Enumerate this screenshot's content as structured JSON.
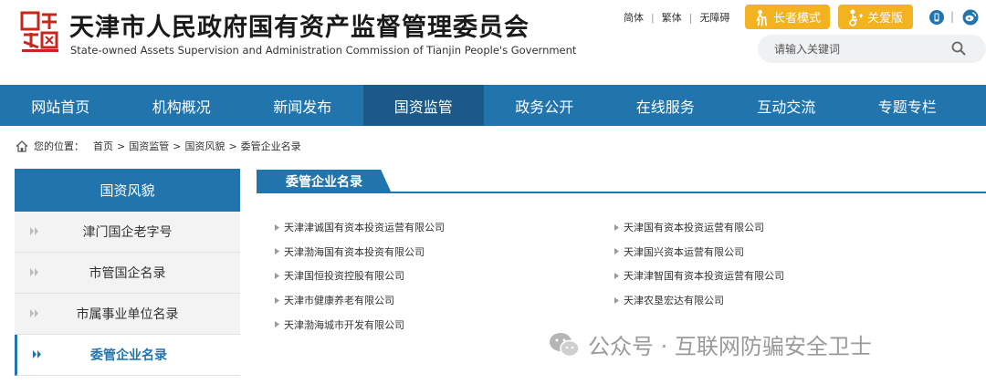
{
  "header": {
    "title": "天津市人民政府国有资产监督管理委员会",
    "subtitle": "State-owned Assets Supervision and Administration Commission of Tianjin People's Government",
    "logo_text": "天津 TIANJIN CHINA",
    "top_links": [
      "简体",
      "繁体",
      "无障碍"
    ],
    "elder_mode": "长者模式",
    "care_mode": "关爱版",
    "search_placeholder": "请输入关键词",
    "accent_color": "#f3b21f"
  },
  "nav": {
    "items": [
      "网站首页",
      "机构概况",
      "新闻发布",
      "国资监管",
      "政务公开",
      "在线服务",
      "互动交流",
      "专题专栏"
    ],
    "active_index": 3,
    "color": "#2274ad",
    "active_color": "#1b5a88"
  },
  "breadcrumb": {
    "label": "您的位置：",
    "items": [
      "首页",
      "国资监管",
      "国资风貌",
      "委管企业名录"
    ]
  },
  "sidebar": {
    "title": "国资风貌",
    "items": [
      "津门国企老字号",
      "市管国企名录",
      "市属事业单位名录",
      "委管企业名录"
    ],
    "active_index": 3
  },
  "content": {
    "tab": "委管企业名录",
    "col1": [
      "天津津诚国有资本投资运营有限公司",
      "天津渤海国有资本投资有限公司",
      "天津国恒投资控股有限公司",
      "天津市健康养老有限公司",
      "天津渤海城市开发有限公司"
    ],
    "col2": [
      "天津国有资本投资运营有限公司",
      "天津国兴资本运营有限公司",
      "天津津智国有资本投资运营有限公司",
      "天津农垦宏达有限公司"
    ]
  },
  "watermark": {
    "text": "公众号 · 互联网防骗安全卫士"
  }
}
